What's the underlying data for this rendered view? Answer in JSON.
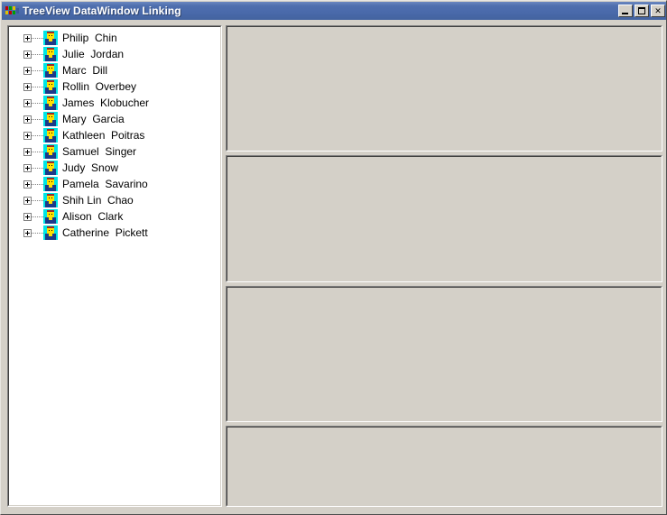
{
  "window": {
    "title": "TreeView DataWindow Linking",
    "icon": "app-icon",
    "buttons": {
      "minimize_label": "_",
      "maximize_label": "□",
      "close_label": "×"
    }
  },
  "treeview": {
    "nodes": [
      {
        "label": "Philip  Chin",
        "expander": "+",
        "icon": "person-icon"
      },
      {
        "label": "Julie  Jordan",
        "expander": "+",
        "icon": "person-icon"
      },
      {
        "label": "Marc  Dill",
        "expander": "+",
        "icon": "person-icon"
      },
      {
        "label": "Rollin  Overbey",
        "expander": "+",
        "icon": "person-icon"
      },
      {
        "label": "James  Klobucher",
        "expander": "+",
        "icon": "person-icon"
      },
      {
        "label": "Mary  Garcia",
        "expander": "+",
        "icon": "person-icon"
      },
      {
        "label": "Kathleen  Poitras",
        "expander": "+",
        "icon": "person-icon"
      },
      {
        "label": "Samuel  Singer",
        "expander": "+",
        "icon": "person-icon"
      },
      {
        "label": "Judy  Snow",
        "expander": "+",
        "icon": "person-icon"
      },
      {
        "label": "Pamela  Savarino",
        "expander": "+",
        "icon": "person-icon"
      },
      {
        "label": "Shih Lin  Chao",
        "expander": "+",
        "icon": "person-icon"
      },
      {
        "label": "Alison  Clark",
        "expander": "+",
        "icon": "person-icon"
      },
      {
        "label": "Catherine  Pickett",
        "expander": "+",
        "icon": "person-icon"
      }
    ]
  },
  "panels": [
    {
      "name": "datawindow-panel-1",
      "content": ""
    },
    {
      "name": "datawindow-panel-2",
      "content": ""
    },
    {
      "name": "datawindow-panel-3",
      "content": ""
    },
    {
      "name": "datawindow-panel-4",
      "content": ""
    }
  ],
  "colors": {
    "titlebar": "#4a6aab",
    "face": "#d4d0c8",
    "tree_background": "#ffffff",
    "icon_background": "#00e5e5",
    "icon_face": "#ffe000",
    "icon_body": "#1c3a8a"
  }
}
